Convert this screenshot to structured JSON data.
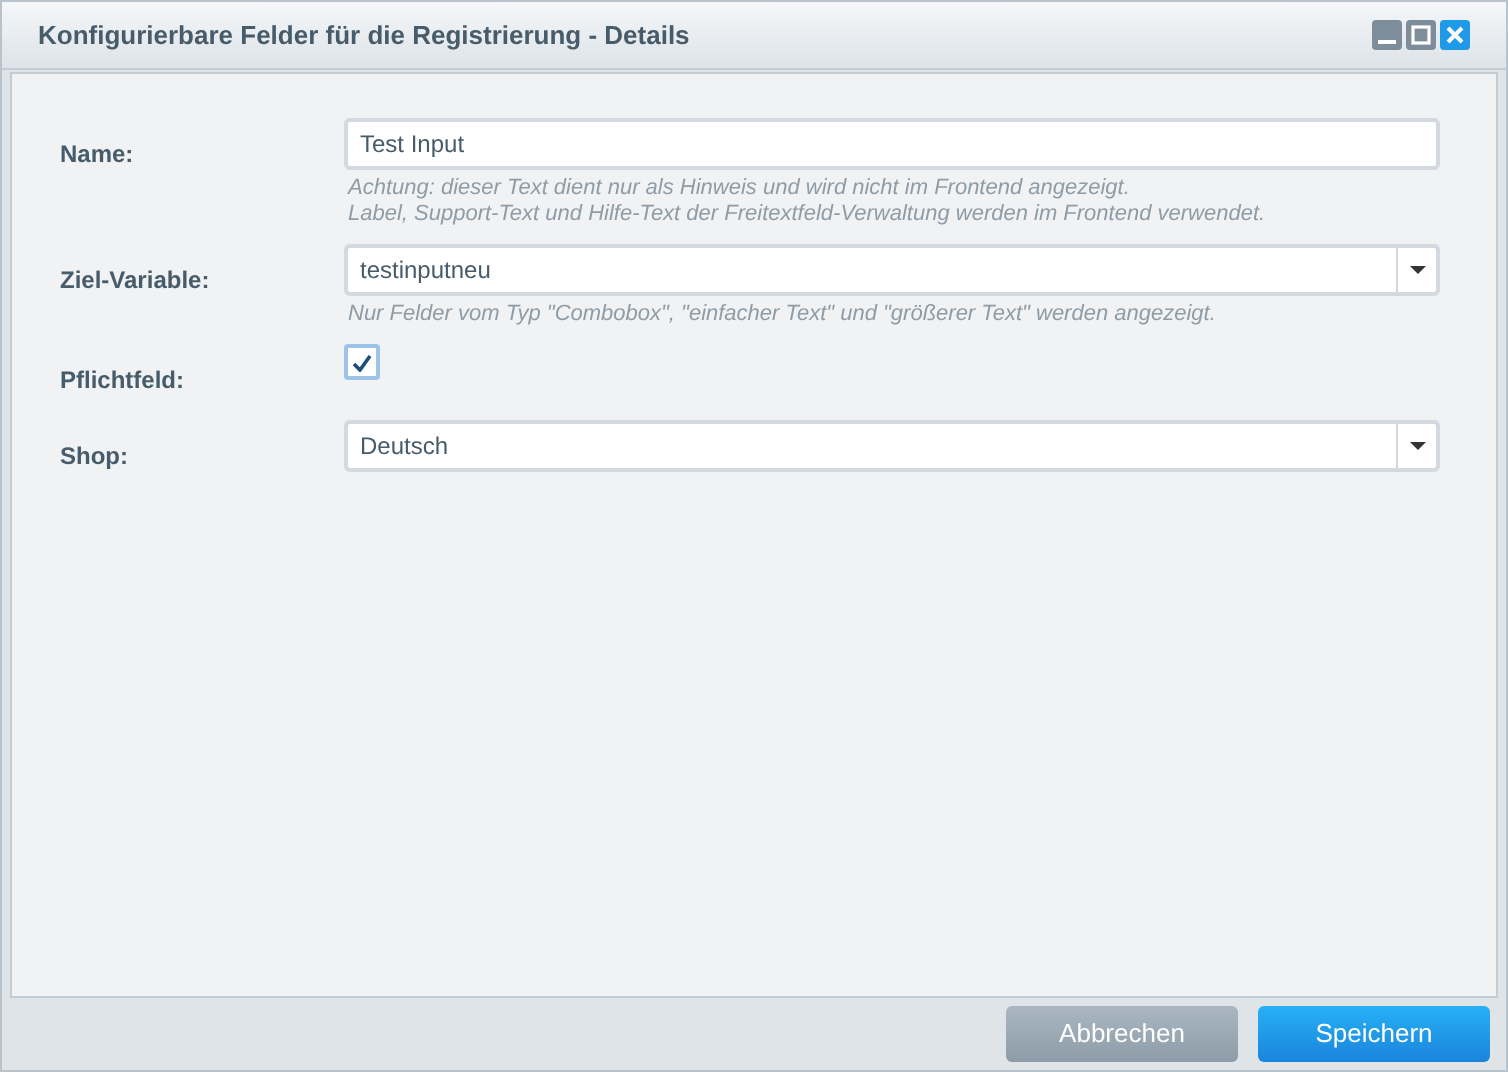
{
  "window": {
    "title": "Konfigurierbare Felder für die Registrierung - Details"
  },
  "fields": [
    {
      "kind": "text",
      "label": "Name:",
      "value": "Test Input",
      "help": [
        "Achtung: dieser Text dient nur als Hinweis und wird nicht im Frontend angezeigt.",
        "Label, Support-Text und Hilfe-Text der Freitextfeld-Verwaltung werden im Frontend verwendet."
      ]
    },
    {
      "kind": "combo",
      "label": "Ziel-Variable:",
      "value": "testinputneu",
      "help": [
        "Nur Felder vom Typ \"Combobox\", \"einfacher Text\" und \"größerer Text\" werden angezeigt."
      ]
    },
    {
      "kind": "checkbox",
      "label": "Pflichtfeld:",
      "checked": true
    },
    {
      "kind": "combo",
      "label": "Shop:",
      "value": "Deutsch"
    }
  ],
  "buttons": [
    {
      "label": "Abbrechen",
      "kind": "secondary"
    },
    {
      "label": "Speichern",
      "kind": "primary"
    }
  ]
}
